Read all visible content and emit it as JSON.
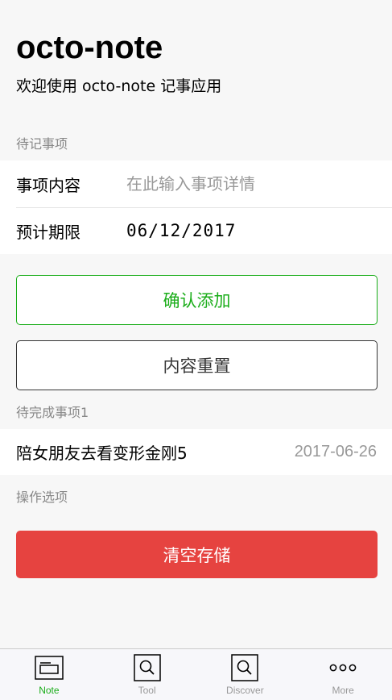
{
  "header": {
    "title": "octo-note",
    "subtitle": "欢迎使用 octo-note 记事应用"
  },
  "form": {
    "section_title": "待记事项",
    "content_label": "事项内容",
    "content_placeholder": "在此输入事项详情",
    "content_value": "",
    "deadline_label": "预计期限",
    "deadline_value": "06/12/2017"
  },
  "buttons": {
    "add_label": "确认添加",
    "reset_label": "内容重置",
    "clear_label": "清空存储"
  },
  "todos": {
    "section_title": "待完成事项1",
    "items": [
      {
        "text": "陪女朋友去看变形金刚5",
        "date": "2017-06-26"
      }
    ]
  },
  "actions": {
    "section_title": "操作选项"
  },
  "tabbar": {
    "tabs": [
      {
        "label": "Note",
        "icon": "note-icon",
        "active": true
      },
      {
        "label": "Tool",
        "icon": "search-icon",
        "active": false
      },
      {
        "label": "Discover",
        "icon": "search-icon",
        "active": false
      },
      {
        "label": "More",
        "icon": "more-icon",
        "active": false
      }
    ]
  },
  "colors": {
    "primary_green": "#1aad19",
    "warn_red": "#e64340",
    "background": "#f7f7f7"
  }
}
